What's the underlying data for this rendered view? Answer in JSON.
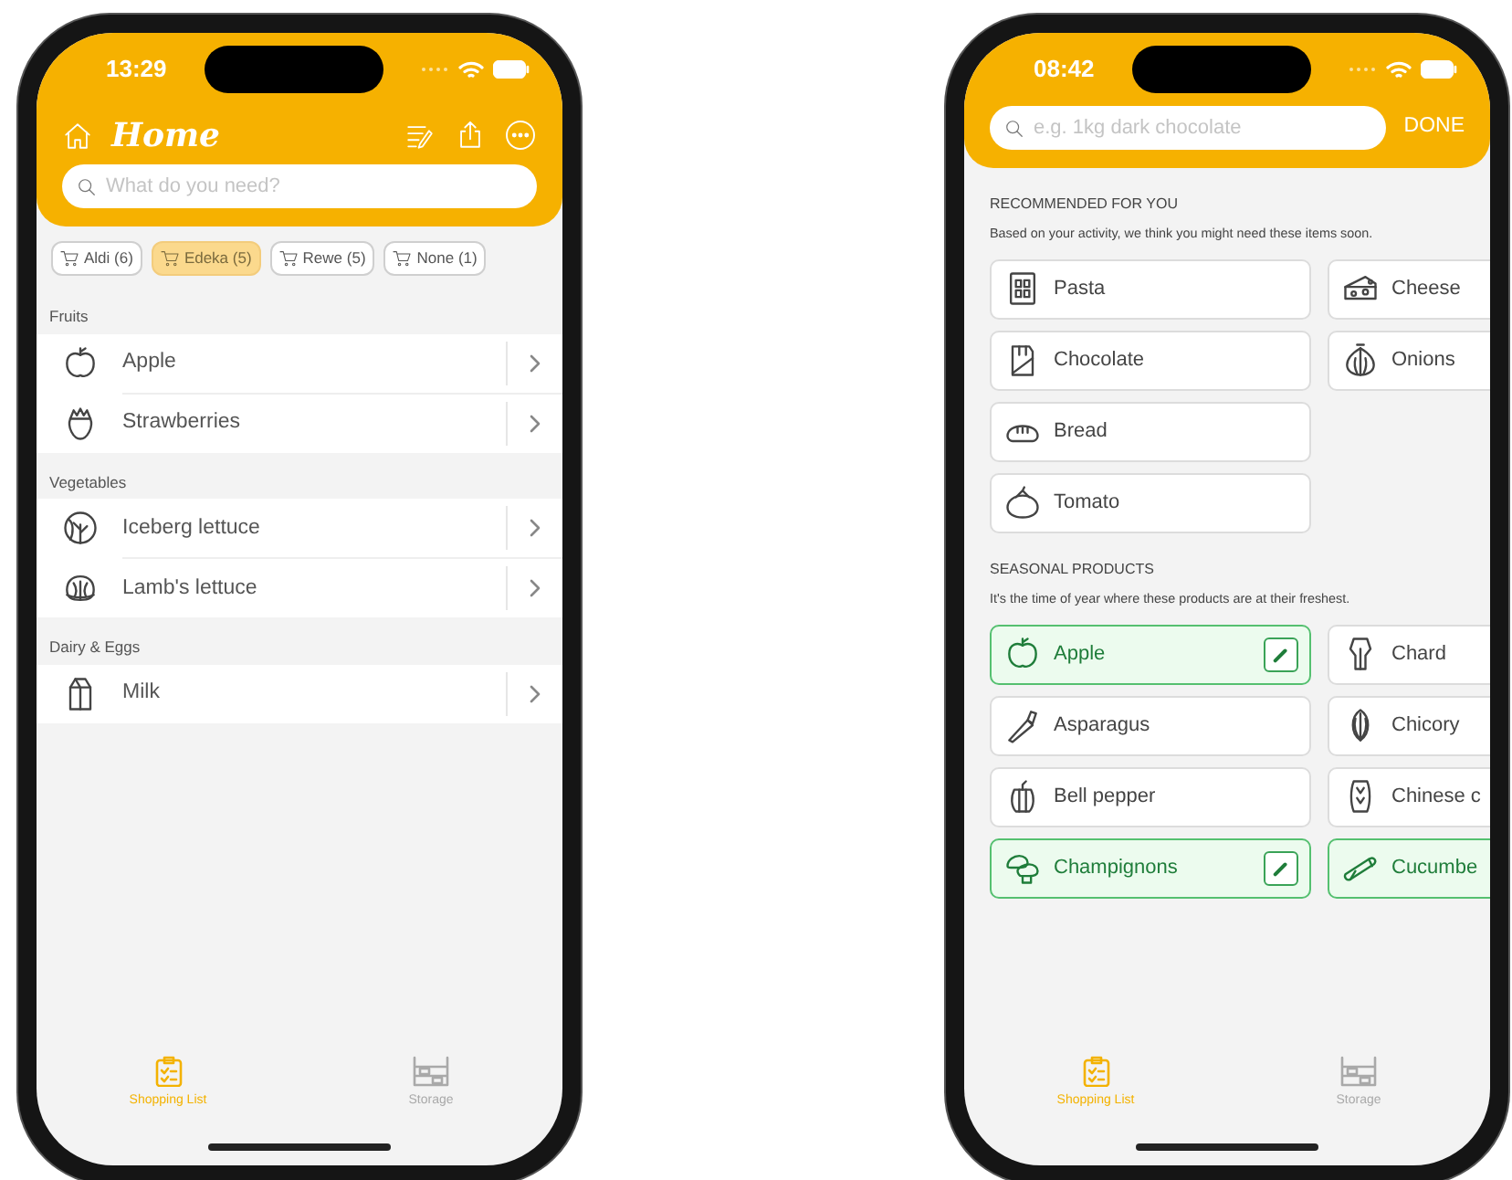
{
  "phones": [
    {
      "kind": "list",
      "status_bar": {
        "time": "13:29"
      },
      "header": {
        "title": "Home"
      },
      "search": {
        "placeholder": "What do you need?"
      },
      "store_filters": [
        {
          "label": "Aldi (6)",
          "selected": false
        },
        {
          "label": "Edeka (5)",
          "selected": true
        },
        {
          "label": "Rewe (5)",
          "selected": false
        },
        {
          "label": "None (1)",
          "selected": false
        }
      ],
      "sections": [
        {
          "title": "Fruits",
          "items": [
            {
              "name": "Apple"
            },
            {
              "name": "Strawberries"
            }
          ]
        },
        {
          "title": "Vegetables",
          "items": [
            {
              "name": "Iceberg lettuce"
            },
            {
              "name": "Lamb's lettuce"
            }
          ]
        },
        {
          "title": "Dairy & Eggs",
          "items": [
            {
              "name": "Milk"
            }
          ]
        }
      ],
      "tab_bar": [
        {
          "label": "Shopping List",
          "selected": true
        },
        {
          "label": "Storage",
          "selected": false
        }
      ]
    },
    {
      "kind": "search",
      "status_bar": {
        "time": "08:42"
      },
      "search": {
        "placeholder": "e.g. 1kg dark chocolate",
        "action": "DONE"
      },
      "sections": [
        {
          "title": "RECOMMENDED FOR YOU",
          "subtitle": "Based on your activity, we think you might need these items soon.",
          "columns": [
            {
              "items": [
                {
                  "name": "Pasta",
                  "selected": false
                },
                {
                  "name": "Chocolate",
                  "selected": false
                },
                {
                  "name": "Bread",
                  "selected": false
                },
                {
                  "name": "Tomato",
                  "selected": false
                }
              ]
            },
            {
              "items": [
                {
                  "name": "Cheese",
                  "selected": false
                },
                {
                  "name": "Onions",
                  "selected": false
                }
              ]
            }
          ]
        },
        {
          "title": "SEASONAL PRODUCTS",
          "subtitle": "It's the time of year where these products are at their freshest.",
          "columns": [
            {
              "items": [
                {
                  "name": "Apple",
                  "selected": true,
                  "edit_button": true
                },
                {
                  "name": "Asparagus",
                  "selected": false
                },
                {
                  "name": "Bell pepper",
                  "selected": false
                },
                {
                  "name": "Champignons",
                  "selected": true,
                  "edit_button": true
                }
              ]
            },
            {
              "items": [
                {
                  "name": "Chard",
                  "selected": false
                },
                {
                  "name": "Chicory",
                  "selected": false
                },
                {
                  "name": "Chinese c",
                  "selected": false
                },
                {
                  "name": "Cucumbe",
                  "selected": true
                }
              ]
            }
          ]
        }
      ],
      "tab_bar": [
        {
          "label": "Shopping List",
          "selected": true
        },
        {
          "label": "Storage",
          "selected": false
        }
      ]
    }
  ]
}
